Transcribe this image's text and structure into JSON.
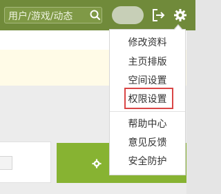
{
  "header": {
    "search_placeholder": "用户/游戏/动态",
    "icons": {
      "search": "search-icon",
      "logout": "logout-icon",
      "settings": "gear-icon"
    }
  },
  "menu": {
    "items": [
      {
        "label": "修改资料"
      },
      {
        "label": "主页排版"
      },
      {
        "label": "空间设置"
      },
      {
        "label": "权限设置",
        "highlighted": true
      },
      {
        "label": "帮助中心"
      },
      {
        "label": "意见反馈"
      },
      {
        "label": "安全防护"
      }
    ]
  },
  "colors": {
    "topbar": "#708a3a",
    "button": "#87b332",
    "highlight_border": "#d94545",
    "notice_bg": "#fffbe7"
  }
}
